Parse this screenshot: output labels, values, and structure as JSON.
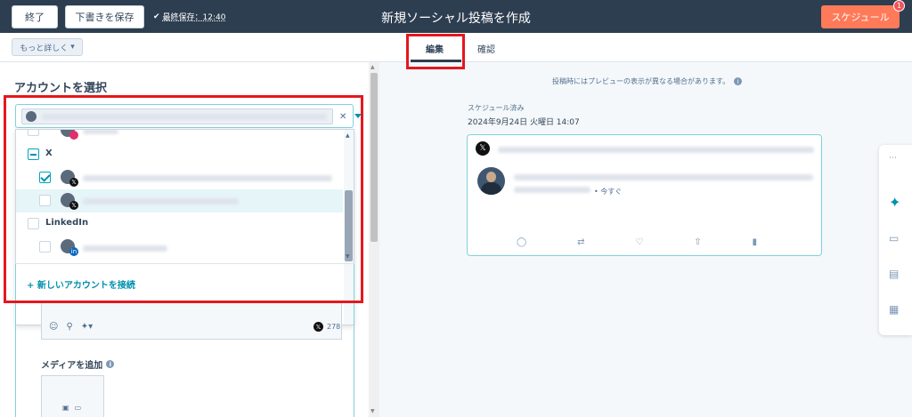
{
  "topbar": {
    "exit_label": "終了",
    "save_draft_label": "下書きを保存",
    "last_saved": "最終保存：12:40",
    "title": "新規ソーシャル投稿を作成",
    "schedule_label": "スケジュール",
    "notification_count": "1"
  },
  "subbar": {
    "more_label": "もっと詳しく",
    "tabs": [
      {
        "label": "編集",
        "active": true
      },
      {
        "label": "確認",
        "active": false
      }
    ]
  },
  "left": {
    "section_title": "アカウントを選択",
    "groups": [
      {
        "label": "X",
        "state": "indeterminate"
      },
      {
        "label": "LinkedIn",
        "state": "unchecked"
      }
    ],
    "connect_label": "+ 新しいアカウントを接続",
    "char_count": "278",
    "media_label": "メディアを追加"
  },
  "preview": {
    "notice": "投稿時にはプレビューの表示が異なる場合があります。",
    "scheduled_label": "スケジュール済み",
    "scheduled_date": "2024年9月24日 火曜日 14:07",
    "post_time": "• 今すぐ"
  },
  "icons": {
    "reply": "reply-icon",
    "repost": "repost-icon",
    "like": "like-icon",
    "share": "share-icon",
    "analytics": "analytics-icon"
  },
  "colors": {
    "header_bg": "#2d3e50",
    "accent": "#ff7a59",
    "teal": "#00a4bd",
    "highlight": "#e5171e"
  }
}
